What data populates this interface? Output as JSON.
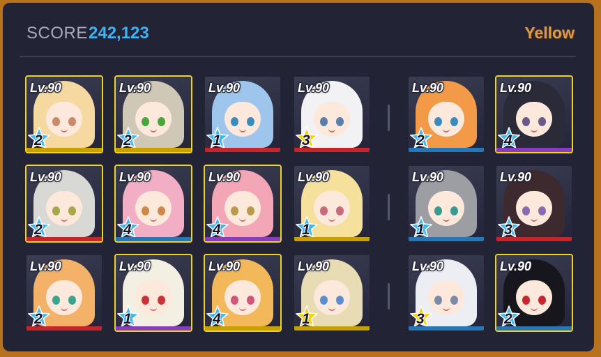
{
  "header": {
    "score_label": "SCORE",
    "score_value": "242,123",
    "team_name": "Yellow"
  },
  "colors": {
    "gold": "#c9a000",
    "red": "#c8242a",
    "blue": "#2677b8",
    "purple": "#8a3cc0",
    "star_blue": "#3fb8ee",
    "star_yellow": "#f7d200",
    "selection": "#f0d221"
  },
  "main_team": [
    {
      "level": "Lv.90",
      "stars": "2",
      "star_color": "blue",
      "bar": "gold",
      "selected": true,
      "hair": "#f6d9a0",
      "eyes": "#c88a6b"
    },
    {
      "level": "Lv.90",
      "stars": "2",
      "star_color": "blue",
      "bar": "gold",
      "selected": true,
      "hair": "#cfc8b6",
      "eyes": "#4aa63b"
    },
    {
      "level": "Lv.90",
      "stars": "1",
      "star_color": "blue",
      "bar": "red",
      "selected": false,
      "hair": "#9ec6ec",
      "eyes": "#3d8bbd"
    },
    {
      "level": "Lv.90",
      "stars": "3",
      "star_color": "yellow",
      "bar": "red",
      "selected": false,
      "hair": "#f2f2f5",
      "eyes": "#5a7fae"
    },
    {
      "level": "Lv.90",
      "stars": "2",
      "star_color": "blue",
      "bar": "red",
      "selected": true,
      "hair": "#d8d8d4",
      "eyes": "#a8a84a"
    },
    {
      "level": "Lv.90",
      "stars": "4",
      "star_color": "blue",
      "bar": "blue",
      "selected": true,
      "hair": "#f2aec4",
      "eyes": "#d0884a"
    },
    {
      "level": "Lv.90",
      "stars": "4",
      "star_color": "blue",
      "bar": "purple",
      "selected": true,
      "hair": "#f2a6b6",
      "eyes": "#b79a4a"
    },
    {
      "level": "Lv.90",
      "stars": "1",
      "star_color": "blue",
      "bar": "gold",
      "selected": false,
      "hair": "#f6e19c",
      "eyes": "#c96a7a"
    },
    {
      "level": "Lv.90",
      "stars": "2",
      "star_color": "blue",
      "bar": "red",
      "selected": false,
      "hair": "#f3b267",
      "eyes": "#3aa58e"
    },
    {
      "level": "Lv.90",
      "stars": "1",
      "star_color": "blue",
      "bar": "purple",
      "selected": true,
      "hair": "#f3efe3",
      "eyes": "#c8343a"
    },
    {
      "level": "Lv.90",
      "stars": "4",
      "star_color": "blue",
      "bar": "gold",
      "selected": true,
      "hair": "#f2b85a",
      "eyes": "#d0567a"
    },
    {
      "level": "Lv.90",
      "stars": "1",
      "star_color": "yellow",
      "bar": "gold",
      "selected": false,
      "hair": "#e8dcb4",
      "eyes": "#5c8ed0"
    }
  ],
  "support_team": [
    {
      "level": "Lv.90",
      "stars": "2",
      "star_color": "blue",
      "bar": "blue",
      "selected": false,
      "hair": "#f29a48",
      "eyes": "#3d8bbd"
    },
    {
      "level": "Lv.90",
      "stars": "4",
      "star_color": "blue",
      "bar": "purple",
      "selected": true,
      "hair": "#2a2a38",
      "eyes": "#6a5a8a"
    },
    {
      "level": "Lv.90",
      "stars": "1",
      "star_color": "blue",
      "bar": "blue",
      "selected": false,
      "hair": "#9c9ea4",
      "eyes": "#3a9a92"
    },
    {
      "level": "Lv.90",
      "stars": "3",
      "star_color": "blue",
      "bar": "red",
      "selected": false,
      "hair": "#3c2a2e",
      "eyes": "#8a6ab0"
    },
    {
      "level": "Lv.90",
      "stars": "3",
      "star_color": "yellow",
      "bar": "blue",
      "selected": false,
      "hair": "#eceef4",
      "eyes": "#7a8aa8"
    },
    {
      "level": "Lv.90",
      "stars": "2",
      "star_color": "blue",
      "bar": "blue",
      "selected": true,
      "hair": "#16161c",
      "eyes": "#c8262e"
    }
  ]
}
